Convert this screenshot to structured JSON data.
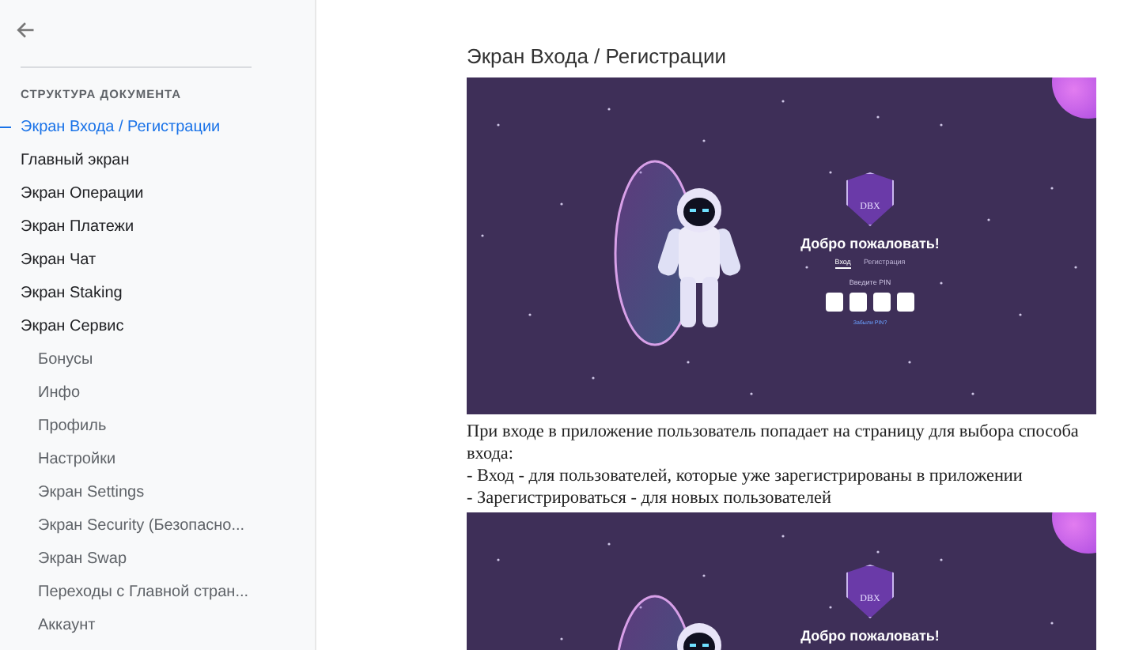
{
  "sidebar": {
    "heading": "СТРУКТУРА ДОКУМЕНТА",
    "items": [
      {
        "label": "Экран Входа / Регистрации",
        "selected": true
      },
      {
        "label": "Главный экран",
        "selected": false
      },
      {
        "label": "Экран Операции",
        "selected": false
      },
      {
        "label": "Экран Платежи",
        "selected": false
      },
      {
        "label": "Экран Чат",
        "selected": false
      },
      {
        "label": "Экран Staking",
        "selected": false
      },
      {
        "label": "Экран Сервис",
        "selected": false,
        "children": [
          {
            "label": "Бонусы",
            "selected": false
          },
          {
            "label": "Инфо",
            "selected": false
          },
          {
            "label": "Профиль",
            "selected": false
          },
          {
            "label": "Настройки",
            "selected": false
          },
          {
            "label": "Экран Settings",
            "selected": false
          },
          {
            "label": "Экран Security (Безопасно...",
            "selected": false
          },
          {
            "label": "Экран Swap",
            "selected": false
          },
          {
            "label": "Переходы с Главной стран...",
            "selected": false
          },
          {
            "label": "Аккаунт",
            "selected": false
          }
        ]
      }
    ]
  },
  "document": {
    "heading": "Экран Входа / Регистрации",
    "blocks": [
      {
        "kind": "mockup",
        "screen": {
          "kind": "tabs",
          "logo_text": "DBX",
          "title": "Добро пожаловать!",
          "tabs": [
            {
              "label": "Вход",
              "selected": true
            },
            {
              "label": "Регистрация",
              "selected": false
            }
          ],
          "pin_label": "Введите PIN",
          "link": "Забыли PIN?"
        }
      },
      {
        "kind": "text",
        "lines": [
          "При входе в приложение пользователь попадает на страницу для выбора способа входа:",
          "- Вход - для пользователей, которые уже зарегистрированы в приложении",
          "- Зарегистрироваться - для новых пользователей"
        ]
      },
      {
        "kind": "mockup",
        "screen": {
          "kind": "plain",
          "logo_text": "DBX",
          "title": "Добро пожаловать!"
        }
      }
    ]
  }
}
